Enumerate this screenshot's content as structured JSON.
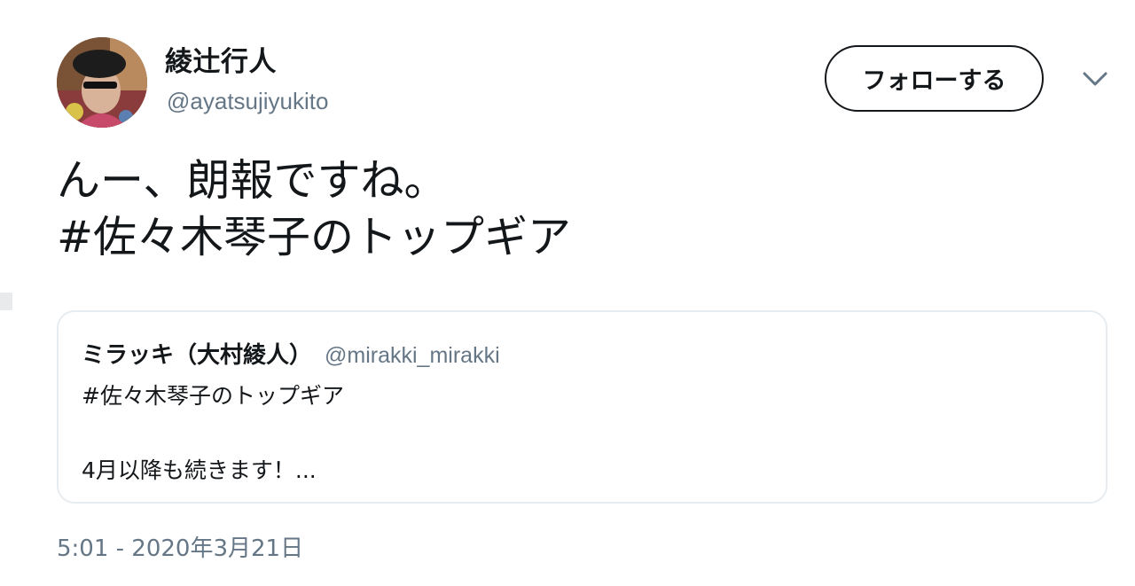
{
  "author": {
    "display_name": "綾辻行人",
    "handle": "@ayatsujiyukito",
    "avatar": "avatar-photo"
  },
  "follow_button": {
    "label": "フォローする"
  },
  "menu": {
    "icon": "chevron-down-icon"
  },
  "tweet": {
    "lines": [
      "んー、朗報ですね。",
      "#佐々木琴子のトップギア"
    ]
  },
  "quote": {
    "display_name": "ミラッキ（大村綾人）",
    "handle": "@mirakki_mirakki",
    "lines": [
      "#佐々木琴子のトップギア",
      "",
      "4月以降も続きます！..."
    ]
  },
  "timestamp": "5:01 - 2020年3月21日",
  "colors": {
    "text": "#14171a",
    "secondary": "#657786",
    "border": "#e6ecf0"
  }
}
